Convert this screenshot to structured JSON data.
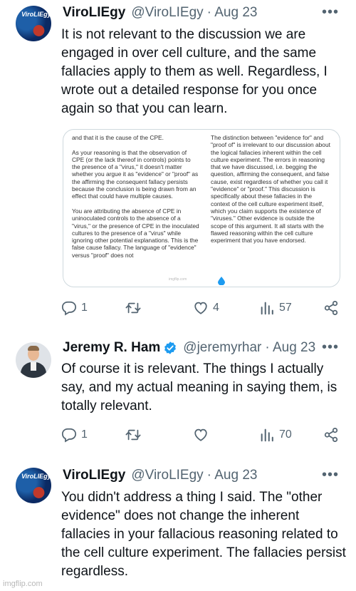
{
  "tweets": [
    {
      "name": "ViroLIEgy",
      "handle": "@ViroLIEgy",
      "date": "· Aug 23",
      "avatar_text": "ViroLIEgy",
      "text": "It is not relevant to the discussion we are engaged in over cell culture, and the same fallacies apply to them as well. Regardless, I wrote out a detailed response for you once again so that you can learn.",
      "media": {
        "left_text": "and that it is the cause of the CPE.\n\nAs your reasoning is that the observation of CPE (or the lack thereof in controls) points to the presence of a \"virus,\" it doesn't matter whether you argue it as \"evidence\" or \"proof\" as the affirming the consequent fallacy persists because the conclusion is being drawn from an effect that could have multiple causes.\n\nYou are attributing the absence of CPE in uninoculated controls to the absence of a \"virus,\" or the presence of CPE in the inoculated cultures to the presence of a \"virus\" while ignoring other potential explanations. This is the false cause fallacy. The language of \"evidence\" versus \"proof\" does not",
        "right_text": "The distinction between \"evidence for\" and \"proof of\" is irrelevant to our discussion about the logical fallacies inherent within the cell culture experiment. The errors in reasoning that we have discussed, i.e. begging the question, affirming the consequent, and false cause, exist regardless of whether you call it \"evidence\" or \"proof.\" This discussion is specifically about these fallacies in the context of the cell culture experiment itself, which you claim supports the existence of \"viruses.\" Other evidence is outside the scope of this argument. It all starts with the flawed reasoning within the cell culture experiment that you have endorsed.",
        "watermark": "imgflip.com"
      },
      "replies": "1",
      "retweets": "",
      "likes": "4",
      "views": "57"
    },
    {
      "name": "Jeremy R. Ham",
      "handle": "@jeremyrhar",
      "date": "· Aug 23",
      "text": "Of course it is relevant. The things I actually say, and my actual meaning in saying them, is totally relevant.",
      "replies": "1",
      "retweets": "",
      "likes": "",
      "views": "70"
    },
    {
      "name": "ViroLIEgy",
      "handle": "@ViroLIEgy",
      "date": "· Aug 23",
      "avatar_text": "ViroLIEgy",
      "text": "You didn't address a thing I said. The \"other evidence\" does not change the inherent fallacies in your fallacious reasoning related to the cell culture experiment. The fallacies persist regardless."
    }
  ],
  "icons": {
    "more": "more-horizontal-icon",
    "reply": "reply-icon",
    "retweet": "retweet-icon",
    "like": "heart-icon",
    "views": "views-chart-icon",
    "share": "share-icon",
    "verified": "verified-badge-icon"
  },
  "colors": {
    "text": "#0f1419",
    "muted": "#536471",
    "verified": "#1d9bf0",
    "border": "#cfd9de"
  },
  "watermark": "imgflip.com"
}
